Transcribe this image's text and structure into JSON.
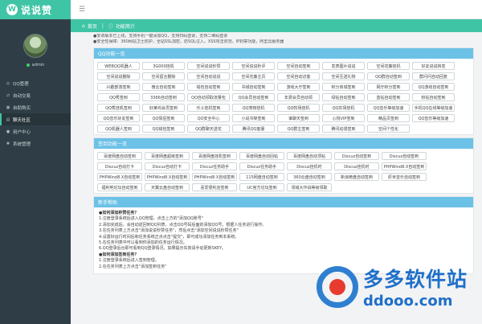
{
  "app": {
    "logo_mark": "W",
    "logo_text": "说说赞"
  },
  "sidebar": {
    "user_name": "admin",
    "items": [
      {
        "label": "QQ管理",
        "icon": "qq-icon"
      },
      {
        "label": "自动交易",
        "icon": "exchange-icon"
      },
      {
        "label": "自助购买",
        "icon": "cart-icon"
      },
      {
        "label": "聊天社区",
        "icon": "chat-icon"
      },
      {
        "label": "用户中心",
        "icon": "user-icon"
      },
      {
        "label": "系统管理",
        "icon": "gear-icon"
      }
    ]
  },
  "breadcrumb": {
    "home": "首页",
    "current": "功能简介"
  },
  "notice": [
    "●安卓版本已上线，支持手机一键添加QQ，支持扫码登录，支持二维码登录",
    "●安全性保障：360网站卫士防护，全站SSL加密，防SQL注入，XSS攻击防范，IP封禁功能，阿里云服务器"
  ],
  "panels": [
    {
      "title": "QQ功能一览",
      "items": [
        "WEBQQ机器人",
        "3G000挂机",
        "空间说说秒赞",
        "空间说说秒评",
        "空间自动签到",
        "发表图片说说",
        "空间花藤挂机",
        "好友说说转发",
        "空间说说删除",
        "空间留言删除",
        "空间自动说说",
        "空间花藤主页",
        "空间自动访客",
        "空间互送礼物",
        "QQ群自动签到",
        "群问问自动回复",
        "兴趣部落签到",
        "微云自动签到",
        "钱包自动签到",
        "书城自动签到",
        "游戏大厅签到",
        "积分商城签到",
        "网厅积分签到",
        "QQ游戏自动签到",
        "QQ秀签到",
        "3366自动签到",
        "QQ自动领取流量包",
        "QQ会员自动签到",
        "年费会员自动领",
        "绿钻自动签到",
        "蓝钻自动签到",
        "粉钻自动签到",
        "QQ秀挂机签到",
        "好莱坞会员签到",
        "乐斗挂机签到",
        "QQ宠物挂机",
        "QQ牧场挂机",
        "QQ农场挂机",
        "QQ音乐等级加速",
        "手机QQ在线等级加速",
        "QQ音乐好友签到",
        "QQ情侣签到",
        "QQ安全中心",
        "小说书架签到",
        "谁聊天签到",
        "心悦VIP签到",
        "精品页签到",
        "QQ音乐等级加速",
        "QQ机器人签到",
        "QQ钱包签到",
        "QQ群聊天送花",
        "腾讯QQ客服",
        "QQ群主签到",
        "腾讯动漫签到",
        "空间个性化"
      ]
    },
    {
      "title": "签到功能一览",
      "items": [
        "百度网盘自动签到",
        "百度网盘超级签到",
        "百度网盘挂机签到",
        "百度网盘自动回帖",
        "百度网盘自动顶帖",
        "Discuz自动签到",
        "Discuz自动签到",
        "Discuz自动打卡",
        "Discuz自动打卡",
        "Discuz任务助手",
        "Discuz任务助手",
        "Discuz挂机时",
        "Discuz挂机时",
        "PHPWind8.X自动签到",
        "PHPWind8.X自动签到",
        "PHPWind8.X自动签到",
        "PHPWind8.X自动签到",
        "115网盘自动签到",
        "360云盘自动签到",
        "新浪微盘自动签到",
        "虾米音乐自动签到",
        "福利吧论坛自动签到",
        "天翼云盘自动签到",
        "喜爱便利店签到",
        "UC官方论坛签到",
        "领域大作战等级领取"
      ]
    }
  ],
  "help": {
    "title": "新手帮助",
    "lines": [
      {
        "text": "●如何添加秒赞任务？",
        "q": true
      },
      {
        "text": "1.注册登录系统后进入QQ管理，点击上方的\"添加QQ账号\"",
        "q": false
      },
      {
        "text": "2.添加完成后，会自动返回到QQ列表，点击QQ号码后面的添加QQ号，根据人任务进行操作。",
        "q": false
      },
      {
        "text": "3.在任务列表上方点击\"添加说说秒赞任务\"，然后点击\"添加空间说说秒赞任务\"",
        "q": false
      },
      {
        "text": "4.设置好运行时间后和任务系统正点点击\"提交\"，即可成功添加任务到本系统。",
        "q": false
      },
      {
        "text": "5.在任务列表中可以看到你添加的任务运行情况。",
        "q": false
      },
      {
        "text": "6.QQ登录后台即可看到QQ登录情况，如果提示失效请手动更新SKEY。",
        "q": false
      },
      {
        "text": "●如何添加签到任务？",
        "q": true
      },
      {
        "text": "1.注册登录系统后进入签到管理，",
        "q": false
      },
      {
        "text": "2.在任务列表上方点击\"添加签到任务\"",
        "q": false
      }
    ]
  },
  "watermark": {
    "cn": "多多软件站",
    "url": "ddooo.com"
  }
}
